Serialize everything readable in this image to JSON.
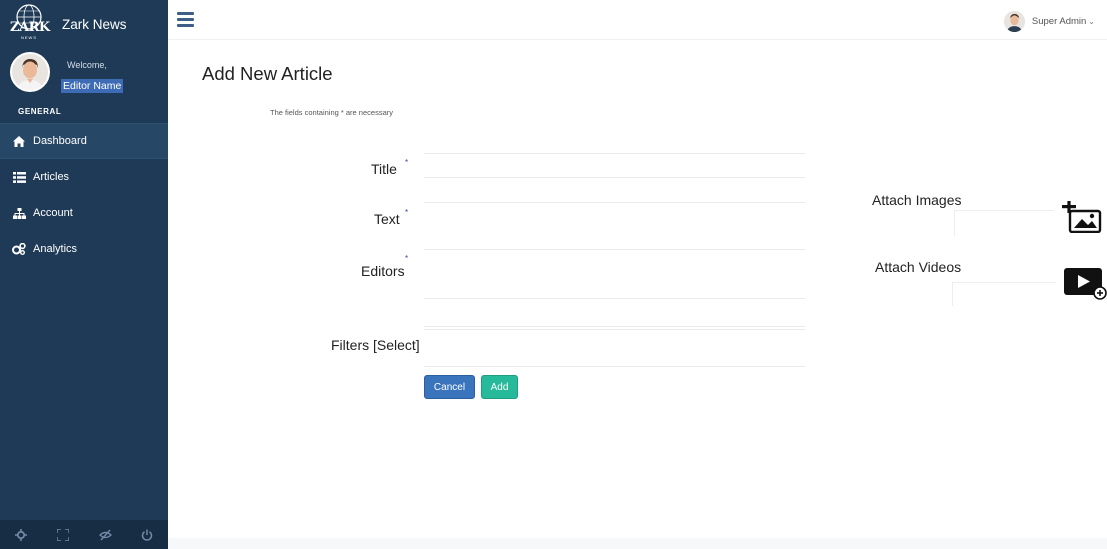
{
  "brand": {
    "logo_text": "ZARK",
    "logo_sub": "NEWS",
    "app_name": "Zark News"
  },
  "profile": {
    "welcome": "Welcome,",
    "editor_name": "Editor Name"
  },
  "sidebar": {
    "section_title": "GENERAL",
    "items": [
      {
        "label": "Dashboard",
        "icon": "home-icon",
        "active": true
      },
      {
        "label": "Articles",
        "icon": "list-icon",
        "active": false
      },
      {
        "label": "Account",
        "icon": "sitemap-icon",
        "active": false
      },
      {
        "label": "Analytics",
        "icon": "cogs-icon",
        "active": false
      }
    ],
    "footer_icons": [
      "settings-icon",
      "fullscreen-icon",
      "hide-icon",
      "power-icon"
    ]
  },
  "topbar": {
    "user_name": "Super Admin"
  },
  "main": {
    "page_title": "Add New Article",
    "hint": "The fields containing * are necessary",
    "fields": {
      "title": "Title",
      "text": "Text",
      "editors": "Editors",
      "filters": "Filters [Select]",
      "required_mark": "*"
    },
    "buttons": {
      "cancel": "Cancel",
      "add": "Add"
    },
    "attachments": {
      "images": "Attach Images",
      "videos": "Attach Videos"
    }
  },
  "colors": {
    "sidebar_bg": "#1f3a56",
    "primary": "#3a74bd",
    "success": "#26b99a"
  }
}
